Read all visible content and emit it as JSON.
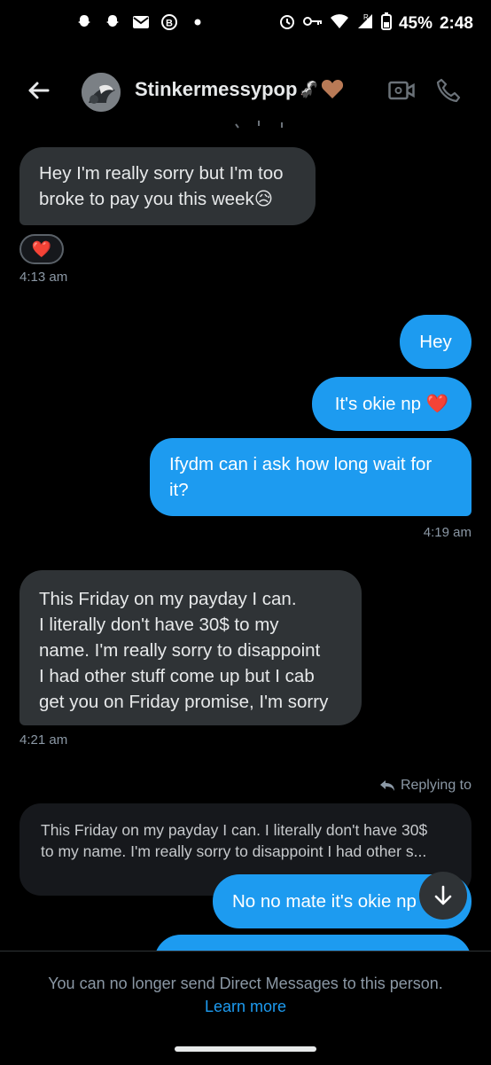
{
  "status_bar": {
    "battery": "45%",
    "time": "2:48",
    "left_icons": [
      "snapchat-icon",
      "snapchat-icon",
      "mail-icon",
      "b-icon",
      "dot-icon"
    ],
    "right_icons": [
      "alarm-icon",
      "key-icon",
      "wifi-icon",
      "signal-icon",
      "battery-icon"
    ]
  },
  "header": {
    "contact_name": "Stinkermessypop",
    "name_emojis": [
      "🦨",
      "🤎"
    ]
  },
  "messages": [
    {
      "dir": "in",
      "text_lines": [
        "Hey I'm really sorry but I'm too",
        "broke to pay you this week😥"
      ],
      "reaction": "❤️",
      "time": "4:13 am"
    },
    {
      "dir": "out",
      "text": "Hey"
    },
    {
      "dir": "out",
      "text": "It's okie np ❤️"
    },
    {
      "dir": "out",
      "text_lines": [
        "Ifydm can i ask how long wait for",
        "it?"
      ],
      "time": "4:19 am"
    },
    {
      "dir": "in",
      "text_lines": [
        "This Friday on my payday I can.",
        "I literally don't have 30$ to my",
        "name. I'm really sorry to disappoint",
        "I had other stuff come up but I cab",
        "get you on Friday promise, I'm sorry"
      ],
      "time": "4:21 am"
    }
  ],
  "reply": {
    "hint": "Replying to",
    "quote_lines": [
      "This Friday on my payday I can. I literally don't have 30$",
      "to my name. I'm really sorry to disappoint I had other s..."
    ],
    "message": "No no mate it's okie np"
  },
  "footer": {
    "message": "You can no longer send Direct Messages to this person.",
    "link": "Learn more"
  },
  "colors": {
    "background": "#000000",
    "incoming_bubble": "#2f3336",
    "outgoing_bubble": "#1d9bf0",
    "link": "#1d9bf0"
  }
}
